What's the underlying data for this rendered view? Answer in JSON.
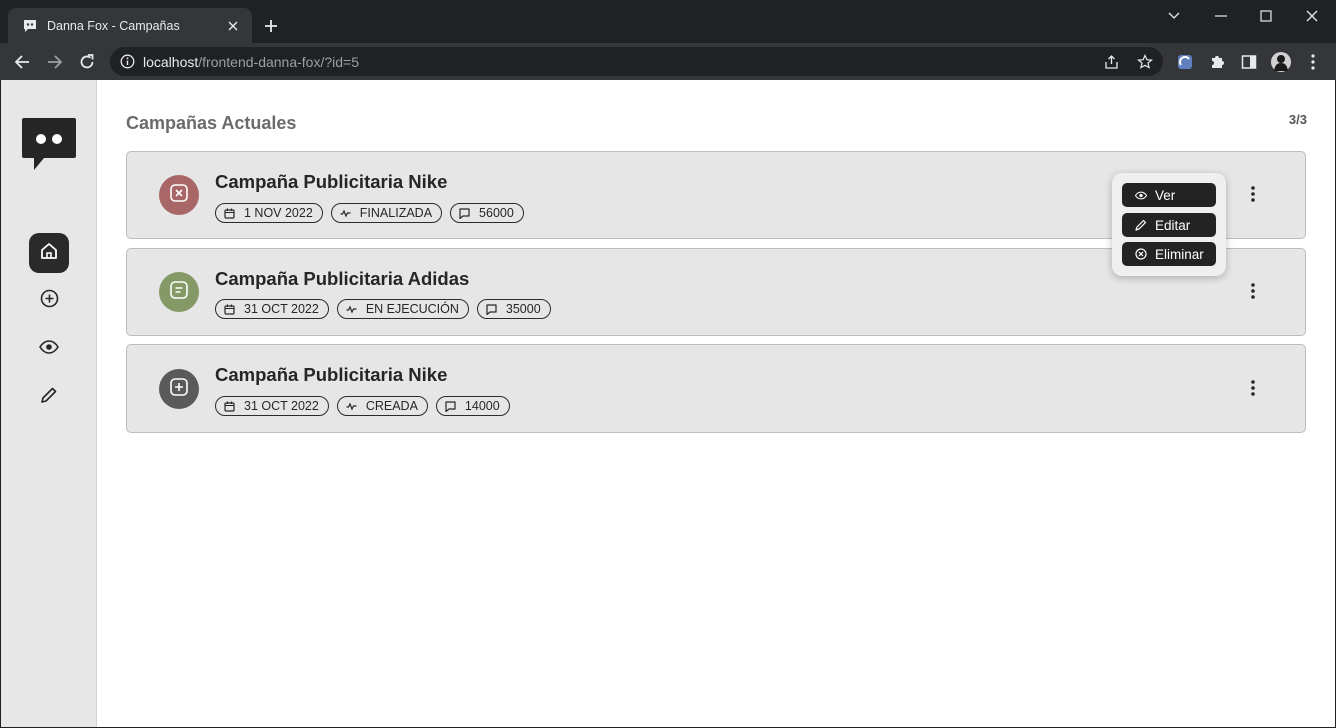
{
  "browser": {
    "tab_title": "Danna Fox - Campañas",
    "url_host": "localhost",
    "url_path": "/frontend-danna-fox/?id=5"
  },
  "page": {
    "title": "Campañas Actuales",
    "count": "3/3"
  },
  "sidebar": {
    "items": [
      {
        "name": "home",
        "icon": "home-icon",
        "active": true
      },
      {
        "name": "create",
        "icon": "plus-circle-icon",
        "active": false
      },
      {
        "name": "view",
        "icon": "eye-icon",
        "active": false
      },
      {
        "name": "edit",
        "icon": "pencil-icon",
        "active": false
      }
    ]
  },
  "campaigns": [
    {
      "title": "Campaña Publicitaria Nike",
      "date": "1 NOV 2022",
      "status": "FINALIZADA",
      "count": "56000",
      "status_icon": "x-square-icon",
      "status_color": "#a86666"
    },
    {
      "title": "Campaña Publicitaria Adidas",
      "date": "31 OCT 2022",
      "status": "EN EJECUCIÓN",
      "count": "35000",
      "status_icon": "message-square-icon",
      "status_color": "#849966"
    },
    {
      "title": "Campaña Publicitaria Nike",
      "date": "31 OCT 2022",
      "status": "CREADA",
      "count": "14000",
      "status_icon": "plus-square-icon",
      "status_color": "#5a5a5a"
    }
  ],
  "menu": {
    "view": "Ver",
    "edit": "Editar",
    "delete": "Eliminar"
  }
}
